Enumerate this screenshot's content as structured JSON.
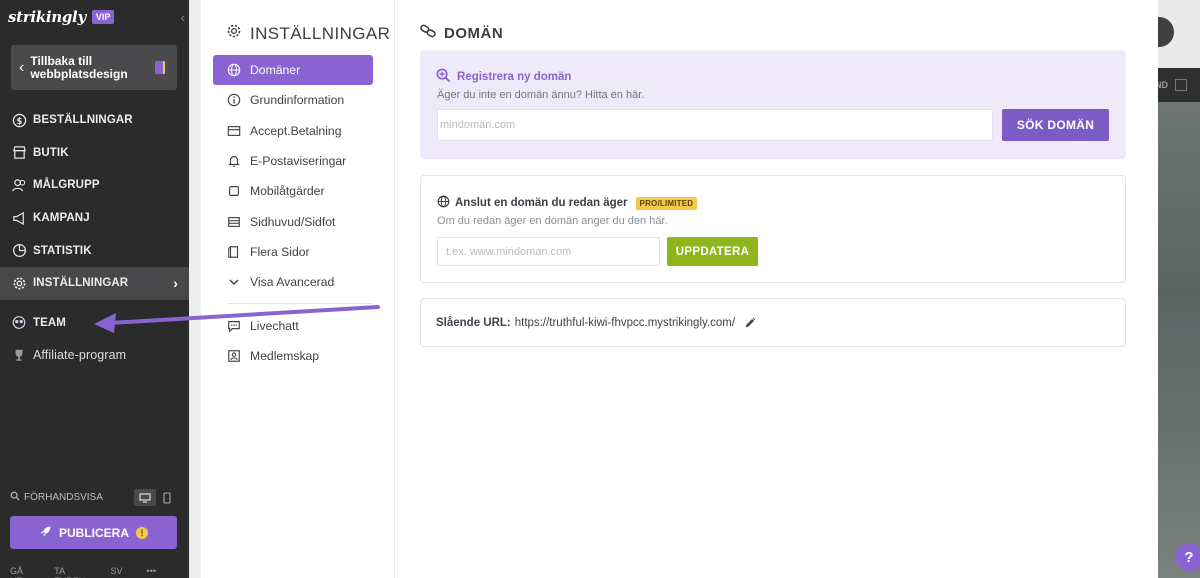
{
  "brand": {
    "logo": "strikingly",
    "badge": "VIP"
  },
  "sidebar": {
    "back_label": "Tillbaka till webbplatsdesign",
    "items": [
      {
        "label": "BESTÄLLNINGAR",
        "icon": "dollar-icon"
      },
      {
        "label": "BUTIK",
        "icon": "store-icon"
      },
      {
        "label": "MÅLGRUPP",
        "icon": "users-icon"
      },
      {
        "label": "KAMPANJ",
        "icon": "megaphone-icon"
      },
      {
        "label": "STATISTIK",
        "icon": "pie-chart-icon"
      },
      {
        "label": "INSTÄLLNINGAR",
        "icon": "gear-icon"
      },
      {
        "label": "TEAM",
        "icon": "team-icon"
      },
      {
        "label": "Affiliate-program",
        "icon": "trophy-icon"
      }
    ],
    "preview_label": "FÖRHANDSVISA",
    "publish_label": "PUBLICERA",
    "publish_warning": "!",
    "footer": {
      "logout": "GÅ UT",
      "tour": "TA TUREN",
      "lang": "SV",
      "more": "•••"
    }
  },
  "settings": {
    "title": "INSTÄLLNINGAR",
    "menu": [
      {
        "label": "Domäner",
        "icon": "globe-icon"
      },
      {
        "label": "Grundinformation",
        "icon": "info-icon"
      },
      {
        "label": "Accept.Betalning",
        "icon": "card-icon"
      },
      {
        "label": "E-Postaviseringar",
        "icon": "bell-icon"
      },
      {
        "label": "Mobilåtgärder",
        "icon": "mobile-icon"
      },
      {
        "label": "Sidhuvud/Sidfot",
        "icon": "layout-icon"
      },
      {
        "label": "Flera Sidor",
        "icon": "pages-icon"
      },
      {
        "label": "Visa Avancerad",
        "icon": "chevron-down-icon"
      },
      {
        "label": "Livechatt",
        "icon": "chat-icon"
      },
      {
        "label": "Medlemskap",
        "icon": "member-icon"
      }
    ]
  },
  "domain": {
    "title": "DOMÄN",
    "register": {
      "heading": "Registrera ny domän",
      "subtext": "Äger du inte en domän ännu? Hitta en här.",
      "placeholder": "mindomän.com",
      "button": "SÖK DOMÄN"
    },
    "connect": {
      "heading": "Anslut en domän du redan äger",
      "badge": "PRO/LIMITED",
      "subtext": "Om du redan äger en domän anger du den här.",
      "placeholder": "t.ex. www.mindoman.com",
      "button": "UPPDATERA"
    },
    "url": {
      "label": "Slående URL:",
      "value": "https://truthful-kiwi-fhvpcc.mystrikingly.com/"
    }
  },
  "preview_strip": {
    "label": "ND"
  },
  "help": {
    "label": "?"
  },
  "colors": {
    "accent": "#8a63d2",
    "green": "#8fb51d",
    "badge": "#f2c94c",
    "sidebar": "#2b2b2c"
  }
}
